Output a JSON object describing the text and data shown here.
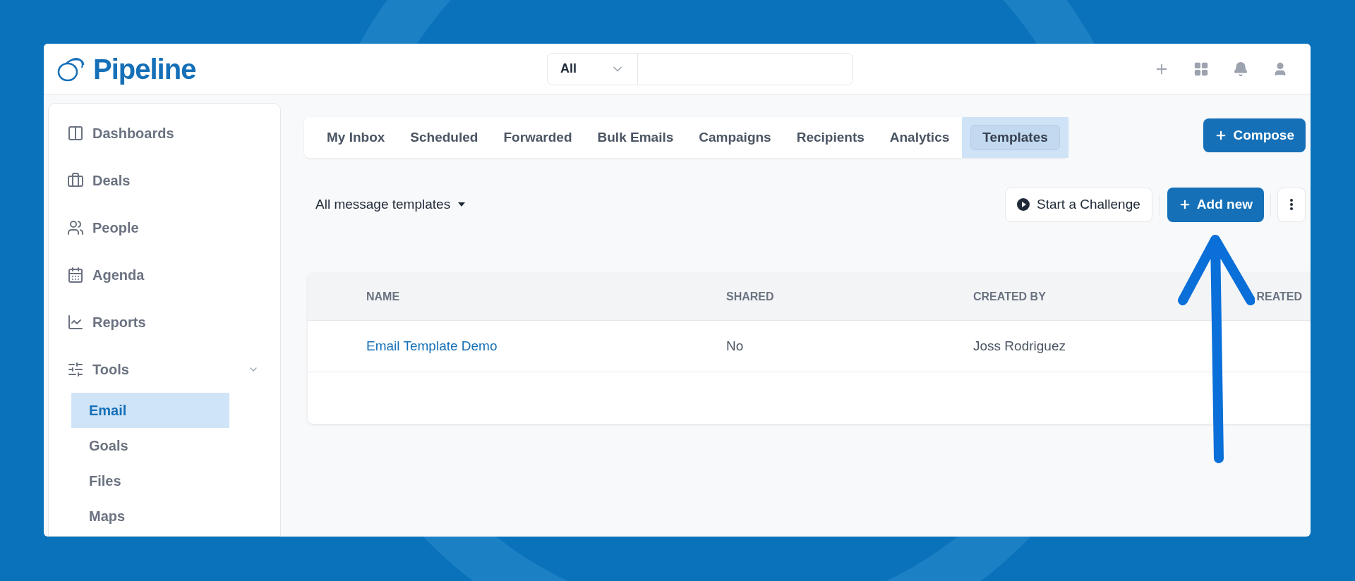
{
  "brand": {
    "name": "Pipeline"
  },
  "search": {
    "scope": "All"
  },
  "sidebar": {
    "items": [
      {
        "label": "Dashboards",
        "selected": false
      },
      {
        "label": "Deals",
        "selected": false
      },
      {
        "label": "People",
        "selected": false
      },
      {
        "label": "Agenda",
        "selected": false
      },
      {
        "label": "Reports",
        "selected": false
      },
      {
        "label": "Tools",
        "selected": false,
        "expanded": true,
        "children": [
          {
            "label": "Email",
            "selected": true
          },
          {
            "label": "Goals",
            "selected": false
          },
          {
            "label": "Files",
            "selected": false
          },
          {
            "label": "Maps",
            "selected": false
          }
        ]
      }
    ]
  },
  "tabs": [
    {
      "label": "My Inbox",
      "selected": false
    },
    {
      "label": "Scheduled",
      "selected": false
    },
    {
      "label": "Forwarded",
      "selected": false
    },
    {
      "label": "Bulk Emails",
      "selected": false
    },
    {
      "label": "Campaigns",
      "selected": false
    },
    {
      "label": "Recipients",
      "selected": false
    },
    {
      "label": "Analytics",
      "selected": false
    },
    {
      "label": "Templates",
      "selected": true
    }
  ],
  "compose_button": "Compose",
  "filter": "All message templates",
  "challenge_button": "Start a Challenge",
  "add_button": "Add new",
  "table": {
    "columns": [
      "NAME",
      "SHARED",
      "CREATED BY",
      "REATED"
    ],
    "rows": [
      {
        "cells": [
          "Email Template Demo",
          "No",
          "Joss Rodriguez"
        ]
      }
    ]
  }
}
